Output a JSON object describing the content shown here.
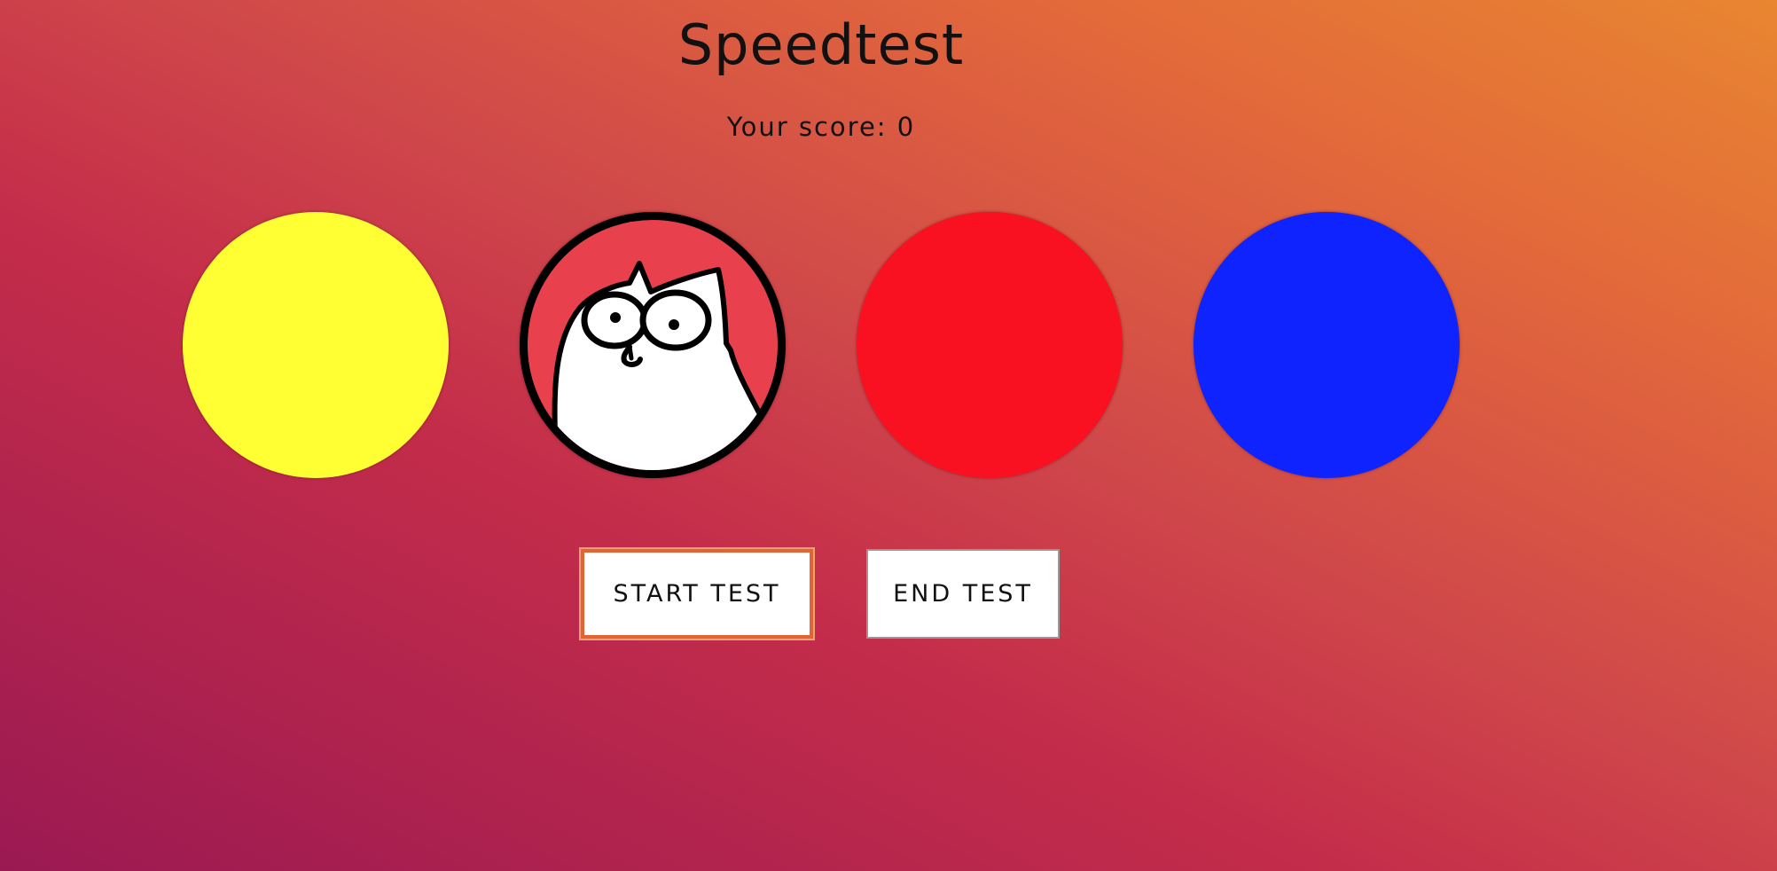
{
  "title": "Speedtest",
  "score": {
    "label": "Your score:",
    "value": "0"
  },
  "circles": [
    {
      "name": "yellow",
      "color": "#ffff33"
    },
    {
      "name": "red-cat",
      "color": "#e8414d",
      "icon": "cat-face-icon"
    },
    {
      "name": "red",
      "color": "#fa1121"
    },
    {
      "name": "blue",
      "color": "#0e23fd"
    }
  ],
  "buttons": {
    "start_label": "START TEST",
    "end_label": "END TEST"
  }
}
